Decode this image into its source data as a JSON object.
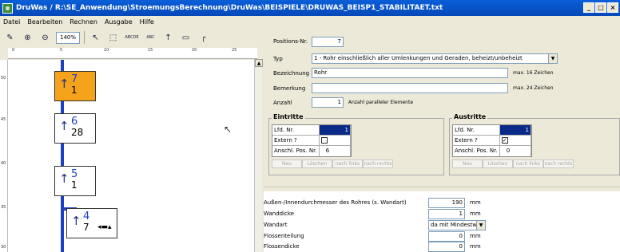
{
  "window": {
    "title": "DruWas  /  R:\\SE_Anwendung\\StroemungsBerechnung\\DruWas\\BEISPIELE\\DRUWAS_BEISP1_STABILITAET.txt",
    "btn_min": "_",
    "btn_max": "□",
    "btn_close": "×"
  },
  "menu": [
    "Datei",
    "Bearbeiten",
    "Rechnen",
    "Ausgabe",
    "Hilfe"
  ],
  "toolbar": {
    "zoom": "140%",
    "label1": "ABCDE",
    "label2": "ABC"
  },
  "ruler": {
    "h": [
      "0",
      "5",
      "10",
      "15",
      "20",
      "25"
    ],
    "v": [
      "50",
      "45",
      "40",
      "35",
      "30"
    ]
  },
  "diagram": [
    {
      "n1": "7",
      "n2": "1",
      "selected": true
    },
    {
      "n1": "6",
      "n2": "28",
      "selected": false
    },
    {
      "n1": "5",
      "n2": "1",
      "selected": false
    },
    {
      "n1": "4",
      "n2": "7",
      "selected": false
    }
  ],
  "form": {
    "pos_label": "Positions-Nr.",
    "pos_value": "7",
    "typ_label": "Typ",
    "typ_value": "1 - Rohr einschließlich aller Umlenkungen und Geraden, beheizt/unbeheizt",
    "bez_label": "Bezeichnung",
    "bez_value": "Rohr",
    "bez_note": "max. 16 Zeichen",
    "bem_label": "Bemerkung",
    "bem_value": "",
    "bem_note": "max. 24 Zeichen",
    "anz_label": "Anzahl",
    "anz_value": "1",
    "anz_note": "Anzahl paralleler Elemente"
  },
  "eintritte": {
    "title": "Eintritte",
    "rows": [
      {
        "label": "Lfd. Nr.",
        "value": "1"
      },
      {
        "label": "Extern ?",
        "value": ""
      },
      {
        "label": "Anschl. Pos. Nr.",
        "value": "6"
      }
    ],
    "buttons": [
      "Neu",
      "Löschen",
      "nach links",
      "nach rechts"
    ]
  },
  "austritte": {
    "title": "Austritte",
    "rows": [
      {
        "label": "Lfd. Nr.",
        "value": "1"
      },
      {
        "label": "Extern ?",
        "value": "✓"
      },
      {
        "label": "Anschl. Pos. Nr.",
        "value": "0"
      }
    ],
    "buttons": [
      "Neu",
      "Löschen",
      "nach links",
      "nach rechts"
    ]
  },
  "params": [
    {
      "label": "Außen-/Innendurchmesser des Rohres (s. Wandart)",
      "value": "190",
      "unit": "mm"
    },
    {
      "label": "Wanddicke",
      "value": "1",
      "unit": "mm"
    },
    {
      "label": "Wandart",
      "value": "da mit Mindestwand",
      "unit": ""
    },
    {
      "label": "Flossenteilung",
      "value": "0",
      "unit": "mm"
    },
    {
      "label": "Flossendicke",
      "value": "0",
      "unit": "mm"
    }
  ],
  "colors": {
    "selected": "#f5a31a",
    "pipe": "#1f3fbf",
    "titlebar": "#0a5fd8"
  }
}
